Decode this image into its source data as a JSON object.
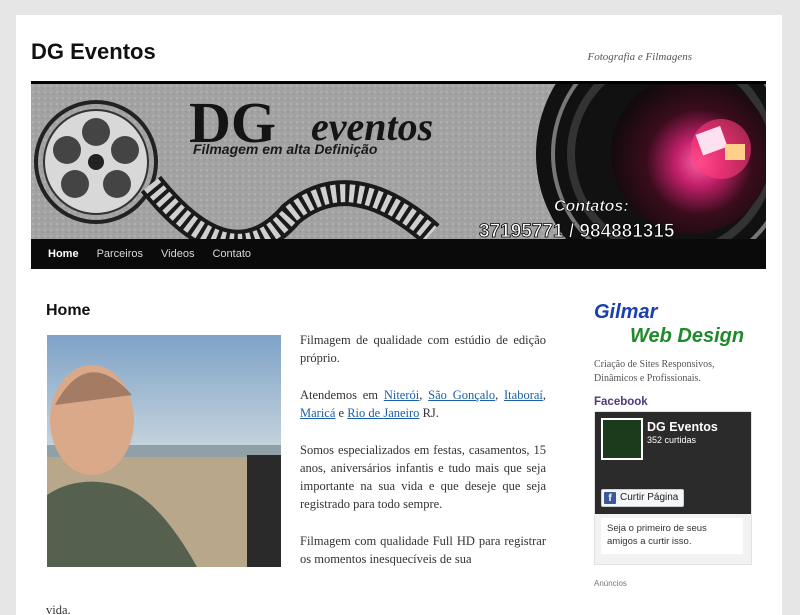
{
  "site": {
    "title": "DG Eventos",
    "description": "Fotografia e Filmagens"
  },
  "banner": {
    "logo_big": "DG",
    "logo_script": "eventos",
    "tagline": "Filmagem em alta Definição",
    "contacts_label": "Contatos:",
    "phones": "37195771 / 984881315"
  },
  "nav": {
    "items": [
      {
        "label": "Home",
        "active": true
      },
      {
        "label": "Parceiros"
      },
      {
        "label": "Videos"
      },
      {
        "label": "Contato"
      }
    ]
  },
  "entry": {
    "title": "Home",
    "p1": "Filmagem de qualidade com estúdio de edição próprio.",
    "p2_prefix": "Atendemos em ",
    "links": [
      "Niterói",
      "São Gonçalo",
      "Itaboraí",
      "Maricá",
      "Rio de Janeiro"
    ],
    "p2_suffix": " RJ.",
    "p3": "Somos especializados em festas, casamentos, 15 anos, aniversários infantis e tudo mais que seja importante na sua vida e que deseje que seja registrado para todo sempre.",
    "p4": "Filmagem com qualidade Full HD para registrar os momentos inesquecíveis de sua",
    "cut_text": "vida."
  },
  "sidebar": {
    "gilmar_line1": "Gilmar",
    "gilmar_line2": "Web Design",
    "gilmar_desc": "Criação de Sites Responsivos, Dinâmicos e Profissionais.",
    "facebook_title": "Facebook",
    "fb": {
      "page_name": "DG Eventos",
      "likes": "352 curtidas",
      "like_button": "Curtir Página",
      "friends_text": "Seja o primeiro de seus amigos a curtir isso."
    },
    "ads_label": "Anúncios"
  },
  "colors": {
    "nav_bg": "#0a0a0a",
    "link": "#1a5fa8",
    "widget_title": "#4d3a78",
    "gilmar_blue": "#1a3fb0",
    "gilmar_green": "#1f8a2a",
    "facebook_blue": "#3b5998"
  }
}
